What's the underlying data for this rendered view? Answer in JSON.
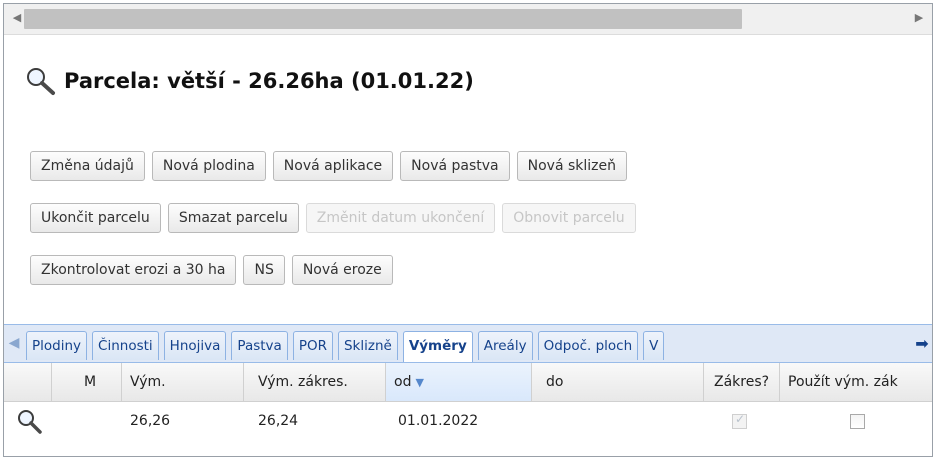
{
  "title": "Parcela: větší - 26.26ha (01.01.22)",
  "buttons": {
    "row1": [
      "Změna údajů",
      "Nová plodina",
      "Nová aplikace",
      "Nová pastva",
      "Nová sklizeň"
    ],
    "row2": [
      "Ukončit parcelu",
      "Smazat parcelu",
      "Změnit datum ukončení",
      "Obnovit parcelu"
    ],
    "row3": [
      "Zkontrolovat erozi a 30 ha",
      "NS",
      "Nová eroze"
    ]
  },
  "tabs": [
    "Plodiny",
    "Činnosti",
    "Hnojiva",
    "Pastva",
    "POR",
    "Sklizně",
    "Výměry",
    "Areály",
    "Odpoč. ploch",
    "V"
  ],
  "active_tab": "Výměry",
  "grid": {
    "columns": [
      "M",
      "Vým.",
      "Vým. zákres.",
      "od",
      "do",
      "Zákres?",
      "Použít vým. zák"
    ],
    "sorted_column": "od",
    "rows": [
      {
        "m": "",
        "vym": "26,26",
        "vym_zakres": "26,24",
        "od": "01.01.2022",
        "do": "",
        "zakres": true,
        "pouzit": false
      }
    ]
  },
  "icons": {
    "title": "magnifier-icon",
    "row": "magnifier-icon",
    "scroll_left": "arrow-left-icon",
    "scroll_right": "arrow-right-icon"
  }
}
